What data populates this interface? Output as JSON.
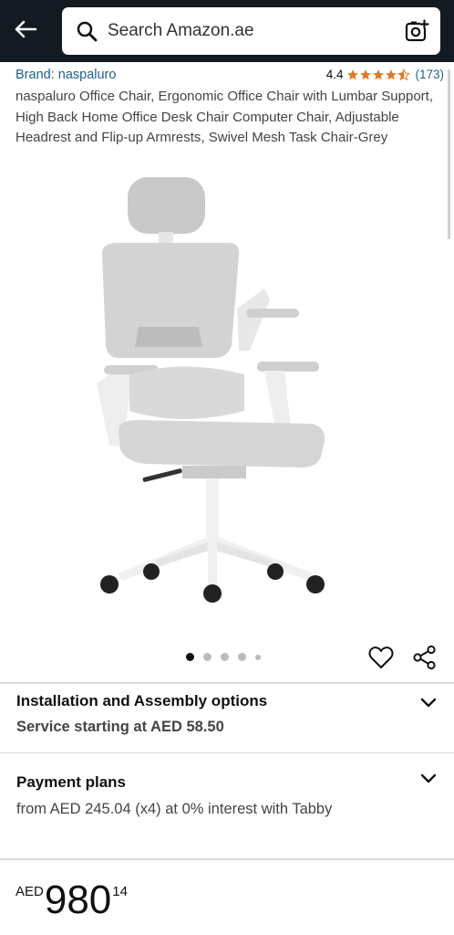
{
  "header": {
    "search_placeholder": "Search Amazon.ae",
    "back_icon": "arrow-left-icon",
    "search_icon": "magnifier-icon",
    "camera_icon": "camera-sparkle-icon"
  },
  "product": {
    "brand": "Brand: naspaluro",
    "rating_value": "4.4",
    "rating_stars": 4.5,
    "rating_count": "(173)",
    "title": "naspaluro Office Chair, Ergonomic Office Chair with Lumbar Support, High Back Home Office Desk Chair Computer Chair, Adjustable Headrest and Flip-up Armrests, Swivel Mesh Task Chair-Grey"
  },
  "carousel": {
    "total_dots": 5,
    "active_index": 0
  },
  "installation": {
    "title": "Installation and Assembly options",
    "subtitle": "Service starting at AED 58.50"
  },
  "payment": {
    "title": "Payment plans",
    "text": "from AED 245.04 (x4) at 0% interest with Tabby"
  },
  "price": {
    "currency": "AED",
    "whole": "980",
    "fraction": "14"
  },
  "colors": {
    "header_bg": "#131a22",
    "link": "#1f5f8f",
    "star": "#de7921"
  }
}
